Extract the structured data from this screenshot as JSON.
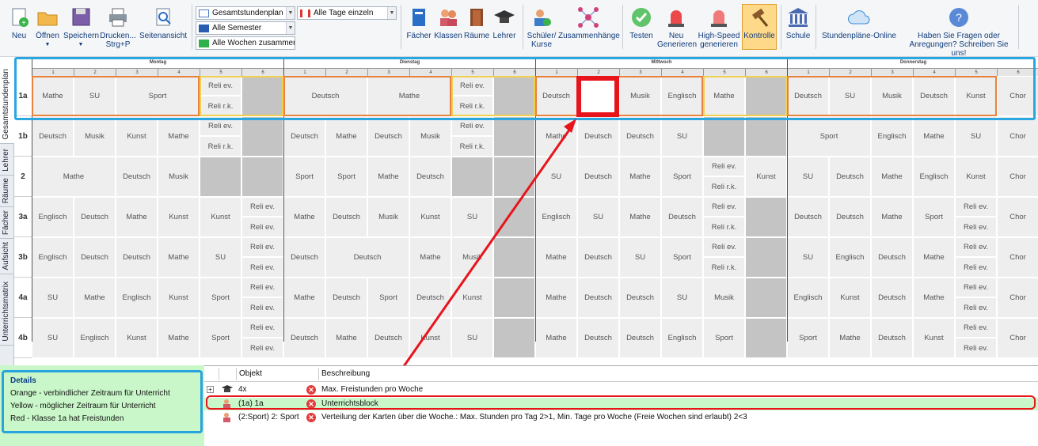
{
  "toolbar": {
    "new": "Neu",
    "open": "Öffnen",
    "save": "Speichern",
    "print": "Drucken...",
    "print2": "Strg+P",
    "preview": "Seitenansicht",
    "view_select": "Gesamtstundenplan",
    "semester_select": "Alle Semester",
    "weeks_select": "Alle Wochen zusammen",
    "days_select": "Alle Tage einzeln",
    "subjects": "Fächer",
    "classes": "Klassen",
    "rooms": "Räume",
    "teachers": "Lehrer",
    "students1": "Schüler/",
    "students2": "Kurse",
    "relations": "Zusammenhänge",
    "test": "Testen",
    "regen1": "Neu",
    "regen2": "Generieren",
    "hs1": "High-Speed",
    "hs2": "generieren",
    "control": "Kontrolle",
    "school": "Schule",
    "online": "Stundenpläne-Online",
    "help1": "Haben Sie Fragen oder",
    "help2": "Anregungen? Schreiben Sie uns!"
  },
  "sidetabs": [
    "Gesamtstundenplan",
    "Lehrer",
    "Räume",
    "Fächer",
    "Aufsicht",
    "Unterrichtsmatrix"
  ],
  "days": [
    "Montag",
    "Dienstag",
    "Mittwoch",
    "Donnerstag"
  ],
  "periods": [
    "1",
    "2",
    "3",
    "4",
    "5",
    "6"
  ],
  "rows": [
    "1a",
    "1b",
    "2",
    "3a",
    "3b",
    "4a",
    "4b"
  ],
  "cells": {
    "r0": [
      [
        "Mathe",
        "SU",
        "Sport",
        "Reli ev.",
        "Reli r.k.",
        ""
      ],
      [
        "Deutsch",
        "Mathe",
        "Reli ev.",
        "Reli r.k."
      ],
      [
        "Deutsch",
        "",
        "Musik",
        "Englisch",
        "Mathe"
      ],
      [
        "Deutsch",
        "SU",
        "Musik",
        "Deutsch",
        "Kunst",
        "Chor"
      ]
    ],
    "r1": [
      [
        "Deutsch",
        "Musik",
        "Kunst",
        "Mathe",
        "Reli ev.",
        "Reli r.k."
      ],
      [
        "Deutsch",
        "Mathe",
        "Deutsch",
        "Musik",
        "Reli ev.",
        "Reli r.k."
      ],
      [
        "Mathe",
        "Deutsch",
        "Deutsch",
        "SU"
      ],
      [
        "Sport",
        "Englisch",
        "Mathe",
        "SU",
        "Chor"
      ]
    ],
    "r2": [
      [
        "Mathe",
        "Deutsch",
        "Musik"
      ],
      [
        "Sport",
        "Sport",
        "Mathe",
        "Deutsch"
      ],
      [
        "SU",
        "Deutsch",
        "Mathe",
        "Sport",
        "Reli ev.",
        "Reli r.k.",
        "Kunst"
      ],
      [
        "SU",
        "Deutsch",
        "Mathe",
        "Englisch",
        "Kunst",
        "Chor"
      ]
    ],
    "r3": [
      [
        "Englisch",
        "Deutsch",
        "Mathe",
        "Kunst",
        "Kunst",
        "Reli ev.",
        "Reli ev."
      ],
      [
        "Mathe",
        "Deutsch",
        "Musik",
        "Kunst",
        "SU"
      ],
      [
        "Englisch",
        "SU",
        "Mathe",
        "Deutsch",
        "Reli ev.",
        "Reli r.k."
      ],
      [
        "Deutsch",
        "Deutsch",
        "Mathe",
        "Sport",
        "Reli ev.",
        "Reli ev.",
        "Chor"
      ]
    ],
    "r4": [
      [
        "Englisch",
        "Deutsch",
        "Deutsch",
        "Mathe",
        "SU",
        "Reli ev.",
        "Reli ev."
      ],
      [
        "Deutsch",
        "Deutsch",
        "Mathe",
        "Musik"
      ],
      [
        "Mathe",
        "Deutsch",
        "SU",
        "Sport",
        "Reli ev.",
        "Reli r.k."
      ],
      [
        "SU",
        "Englisch",
        "Deutsch",
        "Mathe",
        "Reli ev.",
        "Reli ev.",
        "Chor"
      ]
    ],
    "r5": [
      [
        "SU",
        "Mathe",
        "Englisch",
        "Kunst",
        "Sport",
        "Reli ev.",
        "Reli ev."
      ],
      [
        "Mathe",
        "Deutsch",
        "Sport",
        "Deutsch",
        "Kunst"
      ],
      [
        "Mathe",
        "Deutsch",
        "Deutsch",
        "SU",
        "Musik"
      ],
      [
        "Englisch",
        "Kunst",
        "Deutsch",
        "Mathe",
        "Reli ev.",
        "Reli ev.",
        "Chor"
      ]
    ],
    "r6": [
      [
        "SU",
        "Englisch",
        "Kunst",
        "Mathe",
        "Sport",
        "Reli ev.",
        "Reli ev."
      ],
      [
        "Deutsch",
        "Mathe",
        "Deutsch",
        "Kunst",
        "SU"
      ],
      [
        "Mathe",
        "Deutsch",
        "Deutsch",
        "Englisch",
        "Sport"
      ],
      [
        "Sport",
        "Mathe",
        "Deutsch",
        "Kunst",
        "Reli ev.",
        "Reli ev.",
        "Chor"
      ]
    ]
  },
  "details": {
    "title": "Details",
    "l1": "Orange - verbindlicher Zeitraum für Unterricht",
    "l2": "Yellow - möglicher Zeitraum für Unterricht",
    "l3": "Red - Klasse 1a hat Freistunden"
  },
  "errors": {
    "col_obj": "Objekt",
    "col_desc": "Beschreibung",
    "rows": [
      {
        "obj": "4x",
        "desc": "Max. Freistunden pro Woche"
      },
      {
        "obj": "(1a) 1a",
        "desc": "Unterrichtsblock"
      },
      {
        "obj": "(2:Sport) 2: Sport",
        "desc": "Verteilung der Karten über die Woche.: Max. Stunden pro Tag 2>1, Min. Tage pro Woche (Freie Wochen sind erlaubt) 2<3"
      }
    ]
  },
  "colors": {
    "accent": "#2aa6e0",
    "highlight": "#e8141c",
    "orange": "#e8823c",
    "yellow": "#f0d050"
  }
}
